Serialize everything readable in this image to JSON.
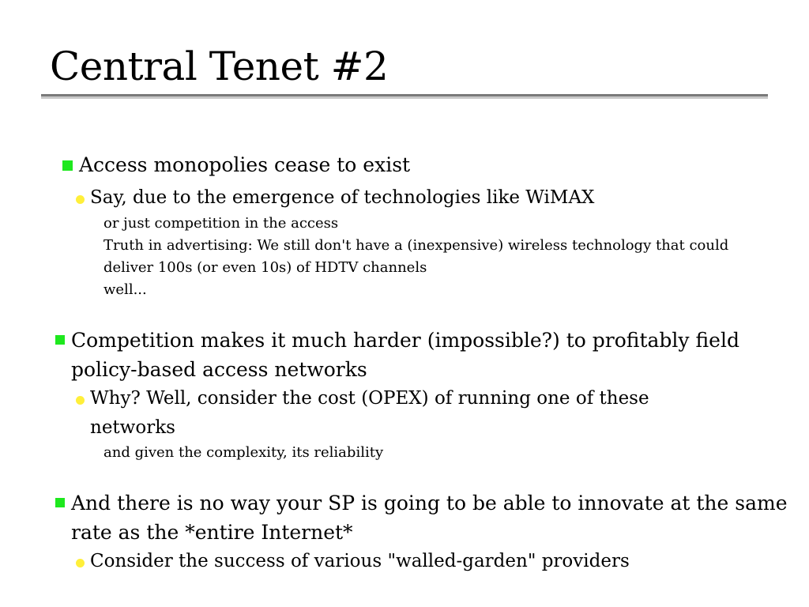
{
  "slide": {
    "title": "Central Tenet #2",
    "points": [
      {
        "text": "Access monopolies cease to exist",
        "sub": {
          "text": "Say, due to the emergence of technologies like WiMAX",
          "details": [
            "or just competition in the access",
            "Truth in advertising: We still don't have a (inexpensive) wireless technology that could",
            "deliver 100s (or even 10s) of HDTV channels",
            "well..."
          ]
        }
      },
      {
        "lines": [
          "Competition makes it much harder (impossible?) to profitably field",
          "policy-based access networks"
        ],
        "sub": {
          "lines": [
            "Why? Well, consider the cost (OPEX) of running one of these",
            "networks"
          ],
          "details": [
            "and given the complexity, its reliability"
          ]
        }
      },
      {
        "lines": [
          "And there is no way your SP is going to be able to innovate at the same",
          "rate as the *entire Internet*"
        ],
        "sub": {
          "text": "Consider the success of various \"walled-garden\" providers"
        }
      }
    ]
  },
  "colors": {
    "level1_bullet": "#1ee81e",
    "level2_bullet": "#ffef3a",
    "rule_dark": "#7a7a7a",
    "rule_light": "#c8c8c8"
  }
}
